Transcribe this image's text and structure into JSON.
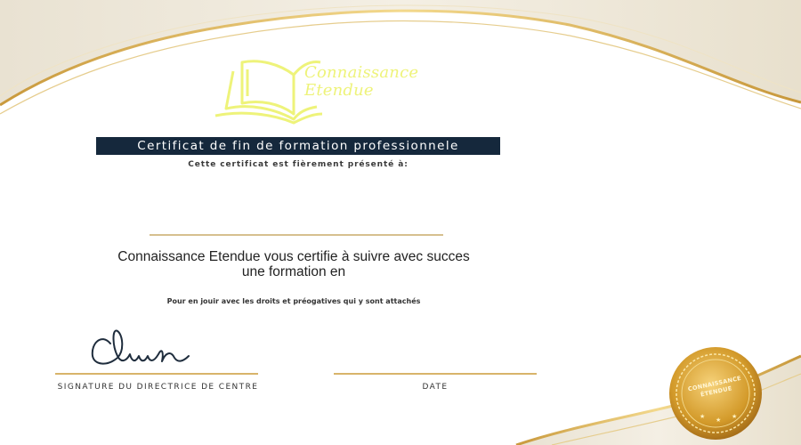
{
  "logo": {
    "line1": "Connaissance",
    "line2": "Etendue",
    "icon": "open-book-icon"
  },
  "title_banner": "Certificat de fin de formation professionnele",
  "presented_to": "Cette certificat est fièrement présenté à:",
  "certify_line1": "Connaissance Etendue vous certifie à suivre avec succes",
  "certify_line2": "une formation en",
  "rights_text": "Pour en jouir avec les droits et préogatives qui y sont attachés",
  "signature_label": "SIGNATURE DU DIRECTRICE DE CENTRE",
  "date_label": "DATE",
  "seal": {
    "line1": "CONNAISSANCE",
    "line2": "ÉTENDUE"
  },
  "colors": {
    "gold": "#d8b46a",
    "banner": "#15283c",
    "logo": "#eef37a"
  }
}
